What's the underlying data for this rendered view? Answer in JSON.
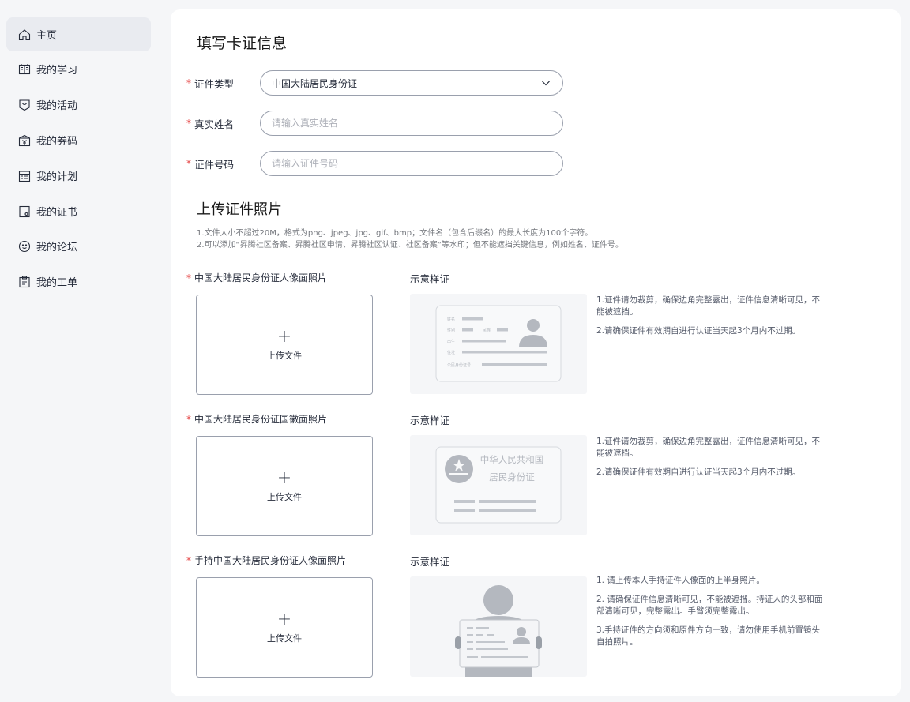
{
  "sidebar": {
    "items": [
      {
        "label": "主页",
        "icon": "home-icon",
        "active": true
      },
      {
        "label": "我的学习",
        "icon": "study-icon"
      },
      {
        "label": "我的活动",
        "icon": "activity-icon"
      },
      {
        "label": "我的券码",
        "icon": "coupon-icon"
      },
      {
        "label": "我的计划",
        "icon": "plan-icon"
      },
      {
        "label": "我的证书",
        "icon": "certificate-icon"
      },
      {
        "label": "我的论坛",
        "icon": "forum-icon"
      },
      {
        "label": "我的工单",
        "icon": "ticket-icon"
      }
    ]
  },
  "form": {
    "title": "填写卡证信息",
    "id_type": {
      "label": "证件类型",
      "value": "中国大陆居民身份证"
    },
    "name": {
      "label": "真实姓名",
      "placeholder": "请输入真实姓名"
    },
    "id_number": {
      "label": "证件号码",
      "placeholder": "请输入证件号码"
    },
    "required_mark": "*"
  },
  "upload": {
    "title": "上传证件照片",
    "note1": "1.文件大小不超过20M，格式为png、jpeg、jpg、gif、bmp；文件名（包含后缀名）的最大长度为100个字符。",
    "note2": "2.可以添加“昇腾社区备案、昇腾社区申请、昇腾社区认证、社区备案”等水印；但不能遮挡关键信息，例如姓名、证件号。",
    "sample_label": "示意样证",
    "upload_text": "上传文件",
    "plus": "+",
    "sections": [
      {
        "label": "中国大陆居民身份证人像面照片",
        "tips": [
          "1.证件请勿裁剪，确保边角完整露出，证件信息清晰可见，不能被遮挡。",
          "2.请确保证件有效期自进行认证当天起3个月内不过期。"
        ],
        "card_fields": [
          "姓名",
          "性别",
          "民族",
          "出生",
          "住址",
          "公民身份证号"
        ]
      },
      {
        "label": "中国大陆居民身份证国徽面照片",
        "tips": [
          "1.证件请勿裁剪，确保边角完整露出，证件信息清晰可见，不能被遮挡。",
          "2.请确保证件有效期自进行认证当天起3个月内不过期。"
        ],
        "card_title_1": "中华人民共和国",
        "card_title_2": "居民身份证"
      },
      {
        "label": "手持中国大陆居民身份证人像面照片",
        "tips": [
          "1. 请上传本人手持证件人像面的上半身照片。",
          "2. 请确保证件信息清晰可见，不能被遮挡。持证人的头部和面部清晰可见，完整露出。手臂须完整露出。",
          "3.手持证件的方向须和原件方向一致，请勿使用手机前置镜头自拍照片。"
        ]
      }
    ]
  }
}
